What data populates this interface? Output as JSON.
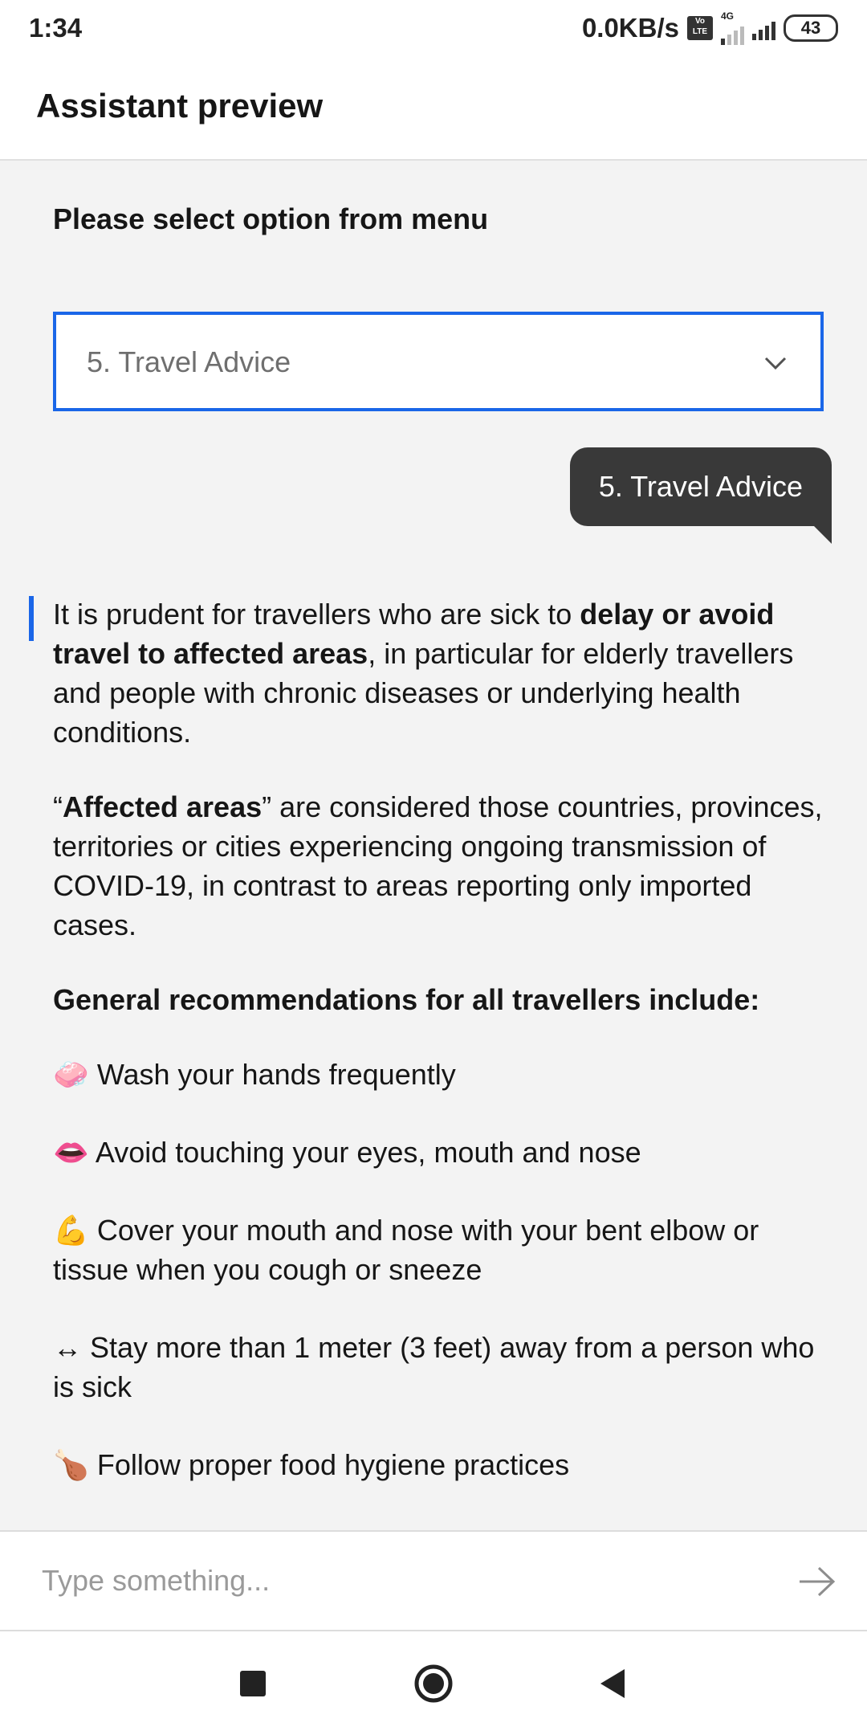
{
  "status_bar": {
    "time": "1:34",
    "net_speed": "0.0KB/s",
    "volte": "Vo LTE",
    "network_type": "4G",
    "battery": "43"
  },
  "header": {
    "title": "Assistant preview"
  },
  "chat": {
    "menu_prompt": "Please select option from menu",
    "dropdown_value": "5. Travel Advice",
    "user_message": "5. Travel Advice",
    "bot": {
      "p1_a": "It is prudent for travellers who are sick to ",
      "p1_b": "delay or avoid travel to affected areas",
      "p1_c": ", in particular for elderly travellers and people with chronic diseases or underlying health conditions.",
      "p2_a": "“",
      "p2_b": "Affected areas",
      "p2_c": "” are considered those countries, provinces, territories or cities experiencing ongoing transmission of COVID-19, in contrast to areas reporting only imported cases.",
      "p3": "General recommendations for all travellers include:",
      "recommendations": [
        {
          "emoji": "🧼",
          "text": " Wash your hands frequently"
        },
        {
          "emoji": "👄",
          "text": " Avoid touching your eyes, mouth and nose"
        },
        {
          "emoji": "💪",
          "text": " Cover your mouth and nose with your bent elbow or tissue when you cough or sneeze"
        },
        {
          "emoji": "↔",
          "text": " Stay more than 1 meter (3 feet) away from a person who is sick"
        },
        {
          "emoji": "🍗",
          "text": " Follow proper food hygiene practices"
        }
      ]
    }
  },
  "input": {
    "placeholder": "Type something..."
  },
  "icons": {
    "send": "arrow-right-icon",
    "dropdown": "chevron-down-icon",
    "nav_recents": "square-icon",
    "nav_home": "circle-icon",
    "nav_back": "triangle-back-icon"
  },
  "colors": {
    "accent": "#1a66e8",
    "user_bubble": "#393939",
    "chat_background": "#f3f3f3"
  }
}
